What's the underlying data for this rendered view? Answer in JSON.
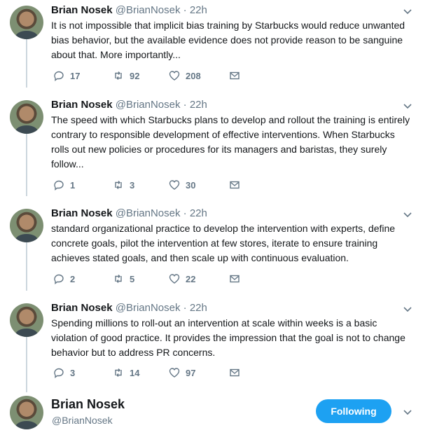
{
  "tweets": [
    {
      "name": "Brian Nosek",
      "handle": "@BrianNosek",
      "dot": "·",
      "time": "22h",
      "text": "It is not impossible that implicit bias training by Starbucks would reduce unwanted bias behavior, but the available evidence does not provide reason to be sanguine about that.  More importantly...",
      "replies": "17",
      "retweets": "92",
      "likes": "208"
    },
    {
      "name": "Brian Nosek",
      "handle": "@BrianNosek",
      "dot": "·",
      "time": "22h",
      "text": "The speed with which Starbucks plans to develop and rollout the training is entirely contrary to responsible development of effective interventions.  When Starbucks rolls out new policies or procedures for its managers and baristas, they surely follow...",
      "replies": "1",
      "retweets": "3",
      "likes": "30"
    },
    {
      "name": "Brian Nosek",
      "handle": "@BrianNosek",
      "dot": "·",
      "time": "22h",
      "text": "standard organizational practice to develop the intervention with experts, define concrete goals, pilot the intervention at few stores, iterate to ensure training achieves stated goals, and then scale up with continuous evaluation.",
      "replies": "2",
      "retweets": "5",
      "likes": "22"
    },
    {
      "name": "Brian Nosek",
      "handle": "@BrianNosek",
      "dot": "·",
      "time": "22h",
      "text": "Spending millions to roll-out an intervention at scale within weeks is a basic violation of good practice. It provides the impression that the goal is not to change behavior but to address PR concerns.",
      "replies": "3",
      "retweets": "14",
      "likes": "97"
    }
  ],
  "profile": {
    "name": "Brian Nosek",
    "handle": "@BrianNosek",
    "follow_label": "Following"
  },
  "icons": {
    "reply": "reply-icon",
    "retweet": "retweet-icon",
    "like": "heart-icon",
    "dm": "envelope-icon",
    "caret": "chevron-down-icon"
  },
  "colors": {
    "accent": "#1da1f2",
    "muted": "#657786",
    "thread_line": "#ccd6dd"
  }
}
